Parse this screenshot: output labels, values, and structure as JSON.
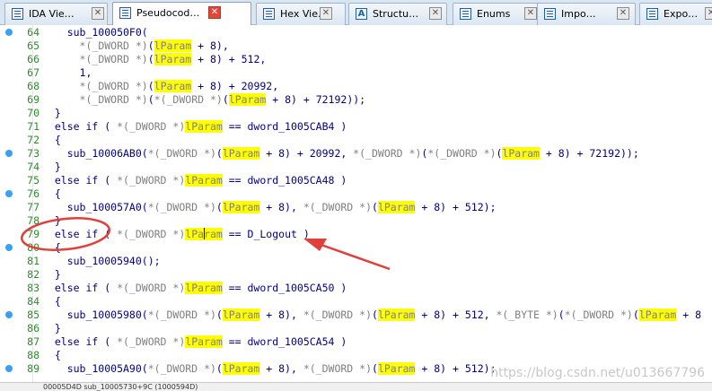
{
  "tabs": [
    {
      "label": "IDA Vie…",
      "icon": "ida-view-icon",
      "active": false
    },
    {
      "label": "Pseudocod…",
      "icon": "pseudocode-icon",
      "active": true
    },
    {
      "label": "Hex Vie…",
      "icon": "hex-view-icon",
      "active": false
    },
    {
      "label": "Structu…",
      "icon": "structures-icon",
      "active": false
    },
    {
      "label": "Enums",
      "icon": "enums-icon",
      "active": false
    },
    {
      "label": "Impo…",
      "icon": "imports-icon",
      "active": false
    },
    {
      "label": "Expo…",
      "icon": "exports-icon",
      "active": false
    }
  ],
  "close_glyph": "✕",
  "code": {
    "line_numbers": [
      "64",
      "65",
      "66",
      "67",
      "68",
      "69",
      "70",
      "71",
      "72",
      "73",
      "74",
      "75",
      "76",
      "77",
      "78",
      "79",
      "80",
      "81",
      "82",
      "83",
      "84",
      "85",
      "86",
      "87",
      "88",
      "89"
    ],
    "lines": [
      "    sub_100050F0(",
      "      *(_DWORD *)(lParam + 8),",
      "      *(_DWORD *)(lParam + 8) + 512,",
      "      1,",
      "      *(_DWORD *)(lParam + 8) + 20992,",
      "      *(_DWORD *)(*(_DWORD *)(lParam + 8) + 72192));",
      "  }",
      "  else if ( *(_DWORD *)lParam == dword_1005CAB4 )",
      "  {",
      "    sub_10006AB0(*(_DWORD *)(lParam + 8) + 20992, *(_DWORD *)(*(_DWORD *)(lParam + 8) + 72192));",
      "  }",
      "  else if ( *(_DWORD *)lParam == dword_1005CA48 )",
      "  {",
      "    sub_100057A0(*(_DWORD *)(lParam + 8), *(_DWORD *)(lParam + 8) + 512);",
      "  }",
      "  else if ( *(_DWORD *)lParam == D_Logout )",
      "  {",
      "    sub_10005940();",
      "  }",
      "  else if ( *(_DWORD *)lParam == dword_1005CA50 )",
      "  {",
      "    sub_10005980(*(_DWORD *)(lParam + 8), *(_DWORD *)(lParam + 8) + 512, *(_BYTE *)(*(_DWORD *)(lParam + 8",
      "  }",
      "  else if ( *(_DWORD *)lParam == dword_1005CA54 )",
      "  {",
      "    sub_10005A90(*(_DWORD *)(lParam + 8), *(_DWORD *)(lParam + 8) + 512);"
    ],
    "breakpoint_lines": [
      "64",
      "73",
      "76",
      "80",
      "85",
      "89"
    ],
    "highlight_word": "lParam",
    "caret_line": "79"
  },
  "status_bar": {
    "text": "00005D4D sub_10005730+9C (1000594D)"
  },
  "watermark": "https://blog.csdn.net/u013667796",
  "annotation": {
    "color": "#e0403a",
    "target": "D_Logout"
  },
  "colors": {
    "code_text": "#000080",
    "cast_text": "#808080",
    "highlight": "#ffff00",
    "line_number": "#2f8a2f",
    "breakpoint_dot": "#3aa0f0"
  }
}
